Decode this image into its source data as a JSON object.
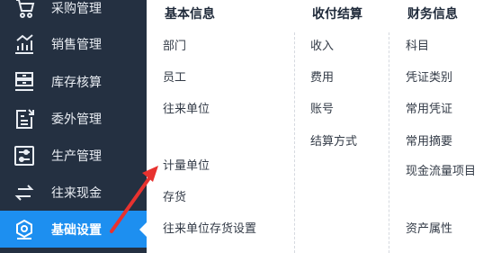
{
  "sidebar": {
    "items": [
      {
        "label": "采购管理",
        "icon": "purchase-icon"
      },
      {
        "label": "销售管理",
        "icon": "sales-chart-icon"
      },
      {
        "label": "库存核算",
        "icon": "inventory-icon"
      },
      {
        "label": "委外管理",
        "icon": "outsource-icon"
      },
      {
        "label": "生产管理",
        "icon": "production-icon"
      },
      {
        "label": "往来现金",
        "icon": "cash-flow-icon"
      },
      {
        "label": "基础设置",
        "icon": "settings-gear-icon",
        "active": true
      }
    ]
  },
  "menu": {
    "columns": [
      {
        "title": "基本信息",
        "items": [
          "部门",
          "员工",
          "往来单位",
          "计量单位",
          "存货",
          "往来单位存货设置"
        ]
      },
      {
        "title": "收付结算",
        "items": [
          "收入",
          "费用",
          "账号",
          "结算方式"
        ]
      },
      {
        "title": "财务信息",
        "items": [
          "科目",
          "凭证类别",
          "常用凭证",
          "常用摘要",
          "现金流量项目",
          "资产属性"
        ]
      }
    ]
  },
  "colors": {
    "sidebar_bg": "#243041",
    "active_bg": "#1d8ff0",
    "annotation_arrow": "#e8322f"
  }
}
